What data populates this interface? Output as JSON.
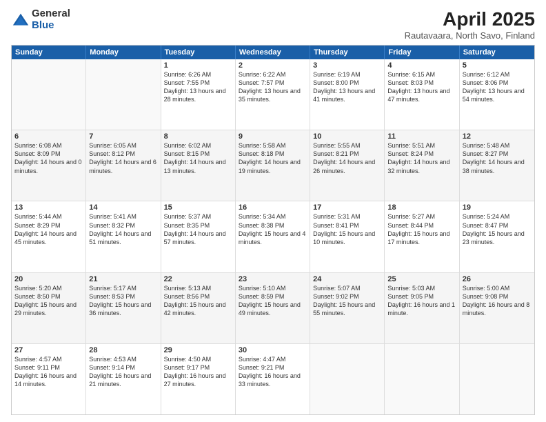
{
  "logo": {
    "general": "General",
    "blue": "Blue"
  },
  "title": "April 2025",
  "subtitle": "Rautavaara, North Savo, Finland",
  "header_days": [
    "Sunday",
    "Monday",
    "Tuesday",
    "Wednesday",
    "Thursday",
    "Friday",
    "Saturday"
  ],
  "weeks": [
    [
      {
        "day": "",
        "sunrise": "",
        "sunset": "",
        "daylight": ""
      },
      {
        "day": "",
        "sunrise": "",
        "sunset": "",
        "daylight": ""
      },
      {
        "day": "1",
        "sunrise": "Sunrise: 6:26 AM",
        "sunset": "Sunset: 7:55 PM",
        "daylight": "Daylight: 13 hours and 28 minutes."
      },
      {
        "day": "2",
        "sunrise": "Sunrise: 6:22 AM",
        "sunset": "Sunset: 7:57 PM",
        "daylight": "Daylight: 13 hours and 35 minutes."
      },
      {
        "day": "3",
        "sunrise": "Sunrise: 6:19 AM",
        "sunset": "Sunset: 8:00 PM",
        "daylight": "Daylight: 13 hours and 41 minutes."
      },
      {
        "day": "4",
        "sunrise": "Sunrise: 6:15 AM",
        "sunset": "Sunset: 8:03 PM",
        "daylight": "Daylight: 13 hours and 47 minutes."
      },
      {
        "day": "5",
        "sunrise": "Sunrise: 6:12 AM",
        "sunset": "Sunset: 8:06 PM",
        "daylight": "Daylight: 13 hours and 54 minutes."
      }
    ],
    [
      {
        "day": "6",
        "sunrise": "Sunrise: 6:08 AM",
        "sunset": "Sunset: 8:09 PM",
        "daylight": "Daylight: 14 hours and 0 minutes."
      },
      {
        "day": "7",
        "sunrise": "Sunrise: 6:05 AM",
        "sunset": "Sunset: 8:12 PM",
        "daylight": "Daylight: 14 hours and 6 minutes."
      },
      {
        "day": "8",
        "sunrise": "Sunrise: 6:02 AM",
        "sunset": "Sunset: 8:15 PM",
        "daylight": "Daylight: 14 hours and 13 minutes."
      },
      {
        "day": "9",
        "sunrise": "Sunrise: 5:58 AM",
        "sunset": "Sunset: 8:18 PM",
        "daylight": "Daylight: 14 hours and 19 minutes."
      },
      {
        "day": "10",
        "sunrise": "Sunrise: 5:55 AM",
        "sunset": "Sunset: 8:21 PM",
        "daylight": "Daylight: 14 hours and 26 minutes."
      },
      {
        "day": "11",
        "sunrise": "Sunrise: 5:51 AM",
        "sunset": "Sunset: 8:24 PM",
        "daylight": "Daylight: 14 hours and 32 minutes."
      },
      {
        "day": "12",
        "sunrise": "Sunrise: 5:48 AM",
        "sunset": "Sunset: 8:27 PM",
        "daylight": "Daylight: 14 hours and 38 minutes."
      }
    ],
    [
      {
        "day": "13",
        "sunrise": "Sunrise: 5:44 AM",
        "sunset": "Sunset: 8:29 PM",
        "daylight": "Daylight: 14 hours and 45 minutes."
      },
      {
        "day": "14",
        "sunrise": "Sunrise: 5:41 AM",
        "sunset": "Sunset: 8:32 PM",
        "daylight": "Daylight: 14 hours and 51 minutes."
      },
      {
        "day": "15",
        "sunrise": "Sunrise: 5:37 AM",
        "sunset": "Sunset: 8:35 PM",
        "daylight": "Daylight: 14 hours and 57 minutes."
      },
      {
        "day": "16",
        "sunrise": "Sunrise: 5:34 AM",
        "sunset": "Sunset: 8:38 PM",
        "daylight": "Daylight: 15 hours and 4 minutes."
      },
      {
        "day": "17",
        "sunrise": "Sunrise: 5:31 AM",
        "sunset": "Sunset: 8:41 PM",
        "daylight": "Daylight: 15 hours and 10 minutes."
      },
      {
        "day": "18",
        "sunrise": "Sunrise: 5:27 AM",
        "sunset": "Sunset: 8:44 PM",
        "daylight": "Daylight: 15 hours and 17 minutes."
      },
      {
        "day": "19",
        "sunrise": "Sunrise: 5:24 AM",
        "sunset": "Sunset: 8:47 PM",
        "daylight": "Daylight: 15 hours and 23 minutes."
      }
    ],
    [
      {
        "day": "20",
        "sunrise": "Sunrise: 5:20 AM",
        "sunset": "Sunset: 8:50 PM",
        "daylight": "Daylight: 15 hours and 29 minutes."
      },
      {
        "day": "21",
        "sunrise": "Sunrise: 5:17 AM",
        "sunset": "Sunset: 8:53 PM",
        "daylight": "Daylight: 15 hours and 36 minutes."
      },
      {
        "day": "22",
        "sunrise": "Sunrise: 5:13 AM",
        "sunset": "Sunset: 8:56 PM",
        "daylight": "Daylight: 15 hours and 42 minutes."
      },
      {
        "day": "23",
        "sunrise": "Sunrise: 5:10 AM",
        "sunset": "Sunset: 8:59 PM",
        "daylight": "Daylight: 15 hours and 49 minutes."
      },
      {
        "day": "24",
        "sunrise": "Sunrise: 5:07 AM",
        "sunset": "Sunset: 9:02 PM",
        "daylight": "Daylight: 15 hours and 55 minutes."
      },
      {
        "day": "25",
        "sunrise": "Sunrise: 5:03 AM",
        "sunset": "Sunset: 9:05 PM",
        "daylight": "Daylight: 16 hours and 1 minute."
      },
      {
        "day": "26",
        "sunrise": "Sunrise: 5:00 AM",
        "sunset": "Sunset: 9:08 PM",
        "daylight": "Daylight: 16 hours and 8 minutes."
      }
    ],
    [
      {
        "day": "27",
        "sunrise": "Sunrise: 4:57 AM",
        "sunset": "Sunset: 9:11 PM",
        "daylight": "Daylight: 16 hours and 14 minutes."
      },
      {
        "day": "28",
        "sunrise": "Sunrise: 4:53 AM",
        "sunset": "Sunset: 9:14 PM",
        "daylight": "Daylight: 16 hours and 21 minutes."
      },
      {
        "day": "29",
        "sunrise": "Sunrise: 4:50 AM",
        "sunset": "Sunset: 9:17 PM",
        "daylight": "Daylight: 16 hours and 27 minutes."
      },
      {
        "day": "30",
        "sunrise": "Sunrise: 4:47 AM",
        "sunset": "Sunset: 9:21 PM",
        "daylight": "Daylight: 16 hours and 33 minutes."
      },
      {
        "day": "",
        "sunrise": "",
        "sunset": "",
        "daylight": ""
      },
      {
        "day": "",
        "sunrise": "",
        "sunset": "",
        "daylight": ""
      },
      {
        "day": "",
        "sunrise": "",
        "sunset": "",
        "daylight": ""
      }
    ]
  ]
}
